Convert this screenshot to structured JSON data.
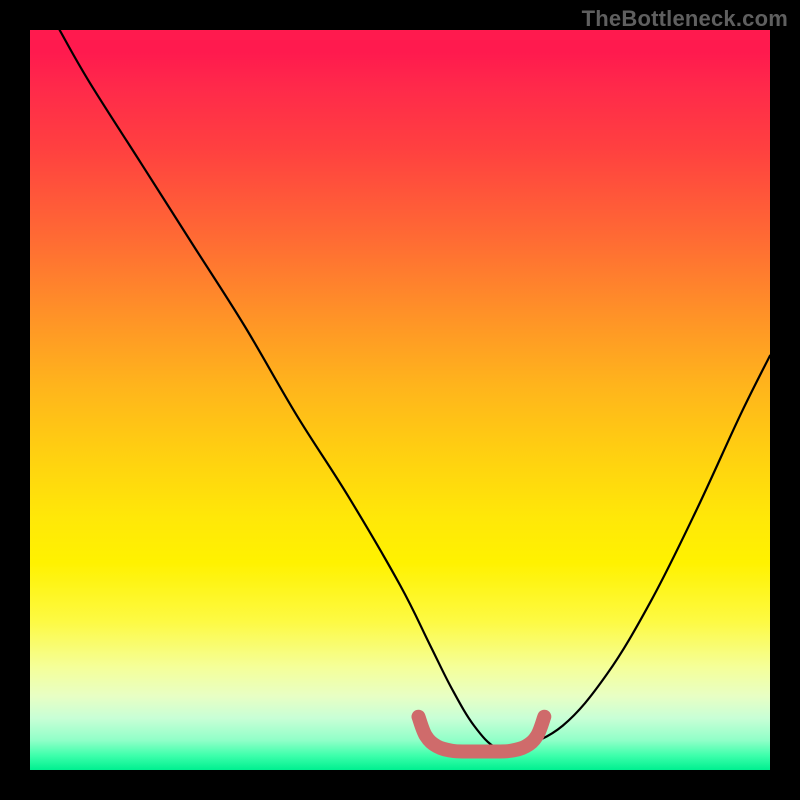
{
  "watermark": "TheBottleneck.com",
  "chart_data": {
    "type": "line",
    "title": "",
    "xlabel": "",
    "ylabel": "",
    "xlim": [
      0,
      100
    ],
    "ylim": [
      0,
      100
    ],
    "grid": false,
    "legend": false,
    "series": [
      {
        "name": "main-curve",
        "color": "#000000",
        "x": [
          4,
          8,
          15,
          22,
          29,
          36,
          43,
          50,
          54,
          57,
          60,
          63,
          66,
          72,
          78,
          84,
          90,
          96,
          100
        ],
        "values": [
          100,
          93,
          82,
          71,
          60,
          48,
          37,
          25,
          17,
          11,
          6,
          3,
          3,
          6,
          13,
          23,
          35,
          48,
          56
        ]
      },
      {
        "name": "flat-marker",
        "color": "#cf6b6b",
        "x": [
          52.5,
          53.5,
          55,
          57,
          59,
          61,
          63,
          65,
          67,
          68.5,
          69.5
        ],
        "values": [
          7.2,
          4.6,
          3.2,
          2.6,
          2.5,
          2.5,
          2.5,
          2.6,
          3.2,
          4.6,
          7.2
        ]
      }
    ],
    "markers": {
      "ends": true,
      "color": "#cf6b6b",
      "size": 10
    },
    "background_gradient": {
      "type": "vertical",
      "stops": [
        {
          "pos": 0.0,
          "color": "#ff1a4e"
        },
        {
          "pos": 0.3,
          "color": "#ff7a30"
        },
        {
          "pos": 0.55,
          "color": "#ffd010"
        },
        {
          "pos": 0.78,
          "color": "#fff600"
        },
        {
          "pos": 0.9,
          "color": "#e8ffc4"
        },
        {
          "pos": 1.0,
          "color": "#00f090"
        }
      ]
    }
  }
}
